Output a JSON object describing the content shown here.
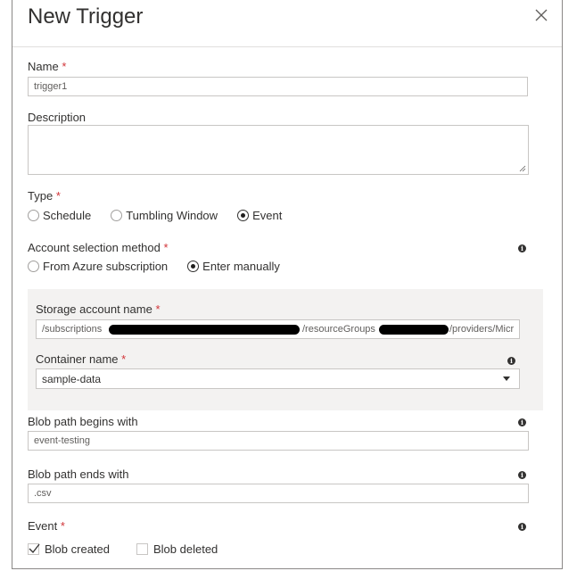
{
  "dialog": {
    "title": "New Trigger"
  },
  "required_mark": "*",
  "fields": {
    "name": {
      "label": "Name",
      "value": "trigger1"
    },
    "description": {
      "label": "Description",
      "value": ""
    },
    "type": {
      "label": "Type",
      "options": [
        "Schedule",
        "Tumbling Window",
        "Event"
      ],
      "selected": "Event"
    },
    "account_selection": {
      "label": "Account selection method",
      "options": [
        "From Azure subscription",
        "Enter manually"
      ],
      "selected": "Enter manually"
    },
    "storage_account": {
      "label": "Storage account name",
      "value_start": "/subscriptions",
      "value_mid": "/resourceGroups",
      "value_end": "/providers/Micr"
    },
    "container": {
      "label": "Container name",
      "value": "sample-data"
    },
    "blob_begins": {
      "label": "Blob path begins with",
      "value": "event-testing"
    },
    "blob_ends": {
      "label": "Blob path ends with",
      "value": ".csv"
    },
    "event": {
      "label": "Event",
      "options": [
        {
          "label": "Blob created",
          "checked": true
        },
        {
          "label": "Blob deleted",
          "checked": false
        }
      ]
    }
  },
  "icons": {
    "close": "close-icon",
    "info": "info-icon",
    "dropdown": "chevron-down-icon"
  },
  "colors": {
    "required": "#d13438",
    "panel_bg": "#f3f2f1",
    "border": "#c8c6c4"
  }
}
